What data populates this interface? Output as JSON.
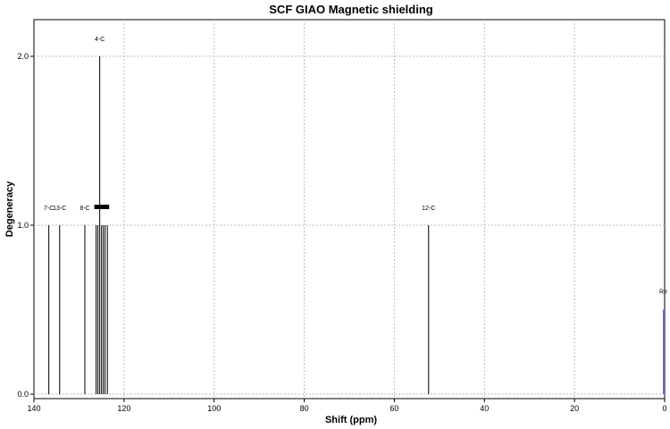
{
  "chart_data": {
    "type": "stem",
    "title": "SCF GIAO Magnetic shielding",
    "xlabel": "Shift (ppm)",
    "ylabel": "Degeneracy",
    "xlim": [
      140,
      0
    ],
    "ylim": [
      0,
      2.25
    ],
    "x_reversed": true,
    "grid": true,
    "x_ticks": [
      "140",
      "120",
      "100",
      "80",
      "60",
      "40",
      "20",
      "0"
    ],
    "y_ticks": [
      "0.0",
      "1.0",
      "2.0"
    ],
    "peaks": [
      {
        "shift": 136.7,
        "degeneracy": 1,
        "label": "7-C"
      },
      {
        "shift": 134.3,
        "degeneracy": 1,
        "label": "13-C"
      },
      {
        "shift": 128.7,
        "degeneracy": 1,
        "label": "8-C"
      },
      {
        "shift": 126.2,
        "degeneracy": 1,
        "label": ""
      },
      {
        "shift": 125.8,
        "degeneracy": 1,
        "label": ""
      },
      {
        "shift": 125.4,
        "degeneracy": 2,
        "label": "4-C"
      },
      {
        "shift": 125.0,
        "degeneracy": 1,
        "label": ""
      },
      {
        "shift": 124.6,
        "degeneracy": 1,
        "label": ""
      },
      {
        "shift": 124.2,
        "degeneracy": 1,
        "label": ""
      },
      {
        "shift": 123.7,
        "degeneracy": 1,
        "label": ""
      },
      {
        "shift": 52.4,
        "degeneracy": 1,
        "label": "12-C"
      }
    ],
    "reference": {
      "shift": 0,
      "degeneracy": 0.5,
      "label": "Re",
      "color": "#6666cc"
    },
    "colors": {
      "peak": "#000000",
      "grid": "#bbbbbb",
      "frame": "#000000"
    }
  }
}
